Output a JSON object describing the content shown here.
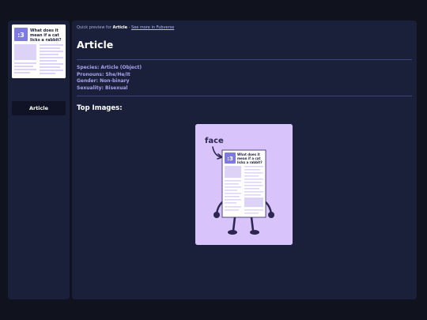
{
  "sidebar": {
    "thumbnail": {
      "logo_text": ":3",
      "headline": "What does it mean if a cat licks a rabbit?"
    },
    "item_label": "Article"
  },
  "breadcrumb": {
    "prefix": "Quick preview for",
    "current": "Article",
    "separator": "-",
    "link": "See more in Fubverse"
  },
  "page": {
    "title": "Article",
    "info": [
      "Species: Article (Object)",
      "Pronouns: She/He/It",
      "Gender: Non-binary",
      "Sexuality: Bisexual"
    ],
    "section_title": "Top Images:"
  },
  "image_card": {
    "caption": "face",
    "logo_text": ":3",
    "headline": "What does it mean if a cat licks a rabbit?"
  },
  "colors": {
    "background": "#10121d",
    "panel": "#1a2039",
    "accent": "#7f7ae0",
    "info_text": "#a9a2ee",
    "card_bg": "#d8c3fa"
  }
}
